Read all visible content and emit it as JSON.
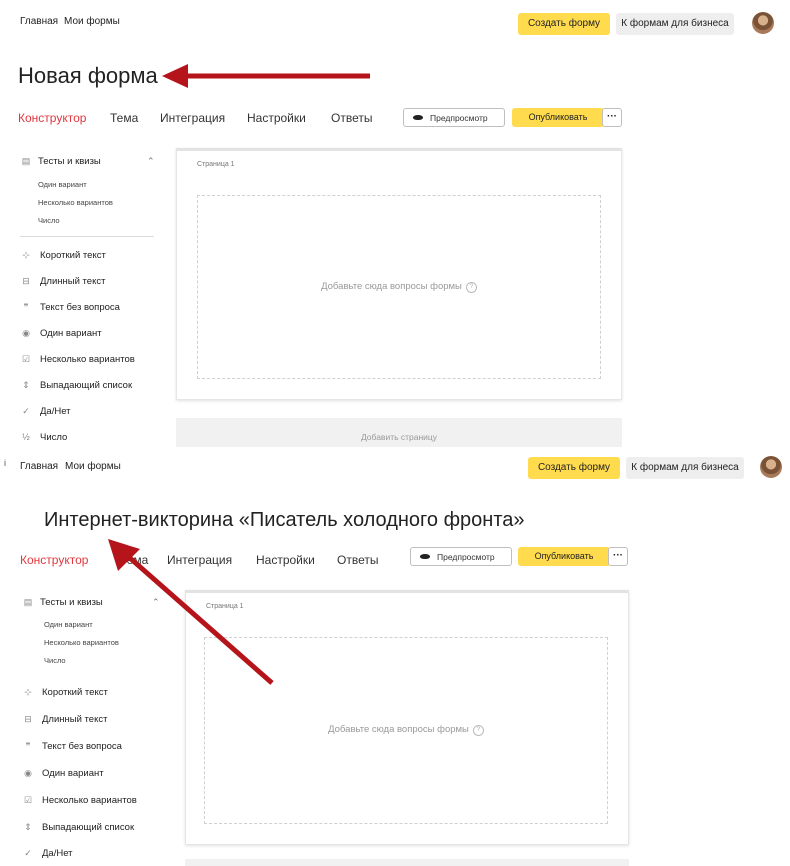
{
  "screens": [
    {
      "nav": {
        "home": "Главная",
        "my_forms": "Мои формы"
      },
      "edge_mark": "",
      "create_form": "Создать форму",
      "for_business": "К формам для бизнеса",
      "form_title": "Новая форма",
      "tabs": [
        "Конструктор",
        "Тема",
        "Интеграция",
        "Настройки",
        "Ответы"
      ],
      "preview": "Предпросмотр",
      "publish": "Опубликовать",
      "more": "···",
      "sidebar": {
        "group": "Тесты и квизы",
        "sub_items": [
          "Один вариант",
          "Несколько вариантов",
          "Число"
        ],
        "items": [
          {
            "icon": "⊹",
            "label": "Короткий текст"
          },
          {
            "icon": "⊟",
            "label": "Длинный текст"
          },
          {
            "icon": "❞",
            "label": "Текст без вопроса"
          },
          {
            "icon": "◉",
            "label": "Один вариант"
          },
          {
            "icon": "☑",
            "label": "Несколько вариантов"
          },
          {
            "icon": "⇕",
            "label": "Выпадающий список"
          },
          {
            "icon": "✓",
            "label": "Да/Нет"
          },
          {
            "icon": "½",
            "label": "Число"
          }
        ]
      },
      "page_label": "Страница 1",
      "dropzone_hint": "Добавьте сюда вопросы формы",
      "help_icon": "?",
      "add_page": "Добавить страницу"
    },
    {
      "nav": {
        "home": "Главная",
        "my_forms": "Мои формы"
      },
      "edge_mark": "i",
      "create_form": "Создать форму",
      "for_business": "К формам для бизнеса",
      "form_title": "Интернет-викторина «Писатель холодного фронта»",
      "tabs": [
        "Конструктор",
        "Тема",
        "Интеграция",
        "Настройки",
        "Ответы"
      ],
      "preview": "Предпросмотр",
      "publish": "Опубликовать",
      "more": "···",
      "sidebar": {
        "group": "Тесты и квизы",
        "sub_items": [
          "Один вариант",
          "Несколько вариантов",
          "Число"
        ],
        "items": [
          {
            "icon": "⊹",
            "label": "Короткий текст"
          },
          {
            "icon": "⊟",
            "label": "Длинный текст"
          },
          {
            "icon": "❞",
            "label": "Текст без вопроса"
          },
          {
            "icon": "◉",
            "label": "Один вариант"
          },
          {
            "icon": "☑",
            "label": "Несколько вариантов"
          },
          {
            "icon": "⇕",
            "label": "Выпадающий список"
          },
          {
            "icon": "✓",
            "label": "Да/Нет"
          }
        ]
      },
      "page_label": "Страница 1",
      "dropzone_hint": "Добавьте сюда вопросы формы",
      "help_icon": "?",
      "add_page": ""
    }
  ],
  "annotation_color": "#b5141b",
  "accent_color": "#e0383e",
  "button_yellow": "#ffdb4d"
}
